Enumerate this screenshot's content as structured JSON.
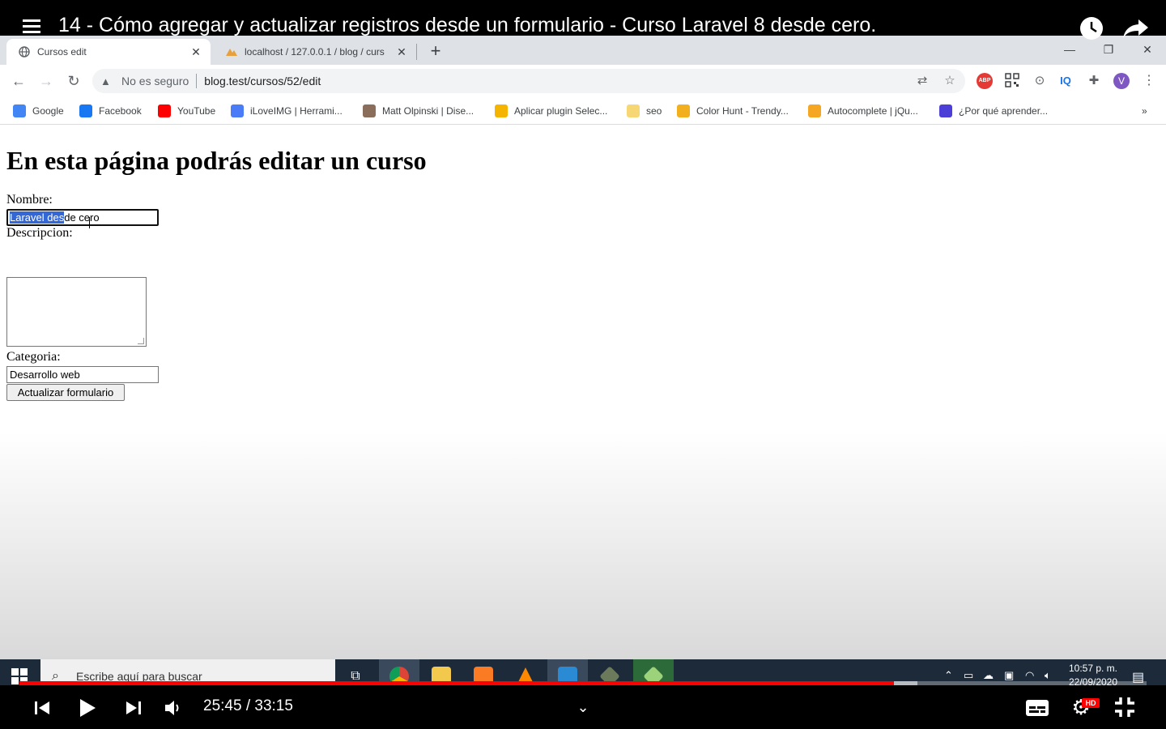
{
  "video": {
    "title": "14 - Cómo agregar y actualizar registros desde un formulario - Curso Laravel 8 desde cero.",
    "time_display": "25:45 / 33:15",
    "played_fraction": 0.776,
    "buffered_fraction": 0.797,
    "quality_badge": "HD",
    "accent_color": "#ff0000"
  },
  "browser": {
    "tabs": [
      {
        "title": "Cursos edit",
        "icon": "globe-icon",
        "active": true
      },
      {
        "title": "localhost / 127.0.0.1 / blog / curs",
        "icon": "phpmyadmin-icon",
        "active": false
      }
    ],
    "security_text": "No es seguro",
    "url": "blog.test/cursos/52/edit",
    "bookmarks": [
      {
        "label": "Google",
        "icon": "google-icon",
        "color": "#4285f4"
      },
      {
        "label": "Facebook",
        "icon": "facebook-icon",
        "color": "#1877f2"
      },
      {
        "label": "YouTube",
        "icon": "youtube-icon",
        "color": "#ff0000"
      },
      {
        "label": "iLoveIMG | Herrami...",
        "icon": "heart-icon",
        "color": "#4a7cf7"
      },
      {
        "label": "Matt Olpinski | Dise...",
        "icon": "avatar-icon",
        "color": "#8a6d5a"
      },
      {
        "label": "Aplicar plugin Selec...",
        "icon": "bookmark-page-icon",
        "color": "#f4b400"
      },
      {
        "label": "seo",
        "icon": "folder-icon",
        "color": "#f7d774"
      },
      {
        "label": "Color Hunt - Trendy...",
        "icon": "colorhunt-icon",
        "color": "#f2b01e"
      },
      {
        "label": "Autocomplete | jQu...",
        "icon": "jquery-icon",
        "color": "#f5a623"
      },
      {
        "label": "¿Por qué aprender...",
        "icon": "site-icon",
        "color": "#4b3fd8"
      }
    ],
    "profile_initial": "V"
  },
  "page": {
    "heading": "En esta página podrás editar un curso",
    "nombre_label": "Nombre:",
    "nombre_value_selected": "Laravel des",
    "nombre_value_rest": "de cero",
    "descripcion_label": "Descripcion:",
    "categoria_label": "Categoria:",
    "categoria_value": "Desarrollo web",
    "submit_label": "Actualizar formulario"
  },
  "taskbar": {
    "search_placeholder": "Escribe aquí para buscar",
    "time": "10:57 p. m.",
    "date": "22/09/2020"
  }
}
